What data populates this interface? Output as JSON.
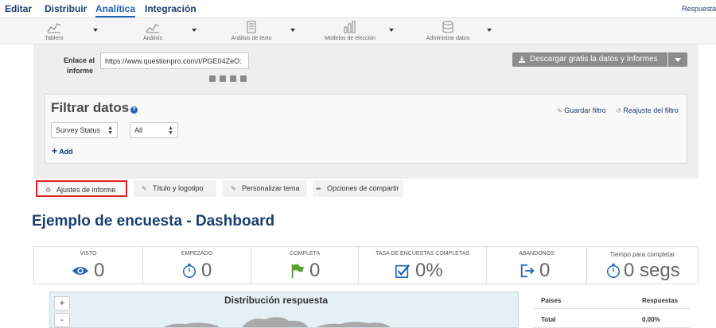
{
  "topnav": {
    "items": [
      "Editar",
      "Distribuir",
      "Analítica",
      "Integración"
    ],
    "right_label": "Respuesta"
  },
  "toolbar": {
    "items": [
      {
        "label": "Tablero",
        "icon": "line-chart-icon"
      },
      {
        "label": "Análisis",
        "icon": "line-chart-icon"
      },
      {
        "label": "Análisis de texto",
        "icon": "text-grid-icon"
      },
      {
        "label": "Modelos de elección",
        "icon": "bar-chart-icon"
      },
      {
        "label": "Administrar datos",
        "icon": "database-icon"
      }
    ]
  },
  "report_link": {
    "label_line1": "Enlace al",
    "label_line2": "informe",
    "value": "https://www.questionpro.com/t/PGE04ZeO:",
    "share_icons": [
      "google-icon",
      "twitter-icon",
      "linkedin-icon",
      "share-icon"
    ]
  },
  "download": {
    "label": "Descargar gratis la datos y Informes"
  },
  "filter": {
    "title": "Filtrar datos",
    "help": "?",
    "save_label": "Guardar filtro",
    "reset_label": "Reajuste del filtro",
    "select1": "Survey Status",
    "select2": "All",
    "add_label": "Add"
  },
  "tabs": [
    {
      "label": "Ajustes de informe",
      "icon": "gears-icon"
    },
    {
      "label": "Título y logotipo",
      "icon": "edit-icon"
    },
    {
      "label": "Personalizar tema",
      "icon": "edit-icon"
    },
    {
      "label": "Opciones de compartir",
      "icon": "share-arrow-icon"
    }
  ],
  "dashboard": {
    "title": "Ejemplo de encuesta - Dashboard"
  },
  "stats": [
    {
      "label": "VISTO",
      "value": "0",
      "icon": "eye-icon"
    },
    {
      "label": "EMPEZADO",
      "value": "0",
      "icon": "stopwatch-icon"
    },
    {
      "label": "COMPLETA",
      "value": "0",
      "icon": "flag-icon"
    },
    {
      "label": "TASA DE ENCUESTAS COMPLETAS",
      "value": "0%",
      "icon": "checkbox-icon"
    },
    {
      "label": "ABANDONOS",
      "value": "0",
      "icon": "exit-icon"
    },
    {
      "label": "Tiempo para completar",
      "value": "0 segs",
      "icon": "stopwatch-icon"
    }
  ],
  "map": {
    "title": "Distribución respuesta",
    "zoom_in": "+",
    "zoom_out": "-"
  },
  "responses_table": {
    "headers": [
      "Países",
      "Respuestas"
    ],
    "rows": [
      {
        "country": "Total",
        "value": "0.00%"
      }
    ]
  },
  "colors": {
    "nav_blue": "#1a3e6e",
    "accent_blue": "#1d63b8",
    "highlight_red": "#e0211f",
    "icon_blue": "#1d63b8",
    "flag_green": "#5aa02c"
  }
}
